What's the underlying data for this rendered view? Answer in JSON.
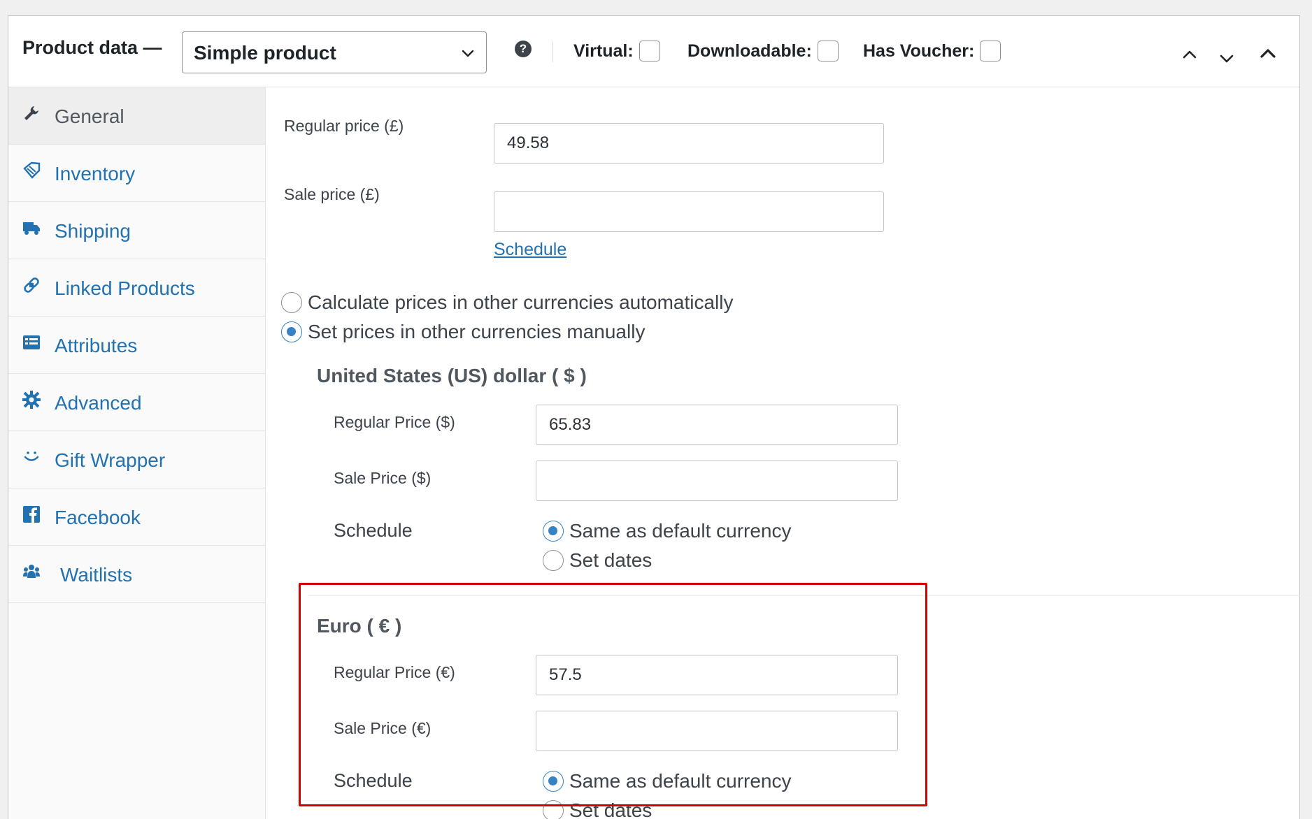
{
  "header": {
    "title": "Product data —",
    "product_type": "Simple product",
    "help_icon": "question-circle-icon",
    "checks": [
      {
        "label": "Virtual:",
        "checked": false
      },
      {
        "label": "Downloadable:",
        "checked": false
      },
      {
        "label": "Has Voucher:",
        "checked": false
      }
    ],
    "buttons": [
      "chevron-up-icon",
      "chevron-down-icon",
      "collapse-arrow-icon"
    ]
  },
  "tabs": [
    {
      "label": "General",
      "icon": "wrench-icon",
      "active": true
    },
    {
      "label": "Inventory",
      "icon": "tag-icon"
    },
    {
      "label": "Shipping",
      "icon": "truck-icon"
    },
    {
      "label": "Linked Products",
      "icon": "link-icon"
    },
    {
      "label": "Attributes",
      "icon": "list-icon"
    },
    {
      "label": "Advanced",
      "icon": "gear-icon"
    },
    {
      "label": "Gift Wrapper",
      "icon": "smile-icon"
    },
    {
      "label": "Facebook",
      "icon": "facebook-icon"
    },
    {
      "label": "Waitlists",
      "icon": "users-icon"
    }
  ],
  "general": {
    "regular_price_label": "Regular price (£)",
    "regular_price_value": "49.58",
    "sale_price_label": "Sale price (£)",
    "sale_price_value": "",
    "schedule_link": "Schedule",
    "currency_mode": {
      "auto_label": "Calculate prices in other currencies automatically",
      "manual_label": "Set prices in other currencies manually",
      "selected": "manual"
    }
  },
  "currencies": [
    {
      "title": "United States (US) dollar ( $ )",
      "regular_label": "Regular Price ($)",
      "regular_value": "65.83",
      "sale_label": "Sale Price ($)",
      "sale_value": "",
      "schedule_label": "Schedule",
      "schedule_same": "Same as default currency",
      "schedule_dates": "Set dates",
      "schedule_selected": "same"
    },
    {
      "title": "Euro ( € )",
      "regular_label": "Regular Price (€)",
      "regular_value": "57.5",
      "sale_label": "Sale Price (€)",
      "sale_value": "",
      "schedule_label": "Schedule",
      "schedule_same": "Same as default currency",
      "schedule_dates": "Set dates",
      "schedule_selected": "same"
    }
  ],
  "colors": {
    "link": "#2271b1",
    "radio_selected": "#3582c4",
    "highlight": "#d00000"
  }
}
